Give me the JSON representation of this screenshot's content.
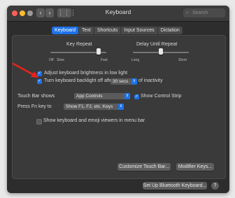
{
  "window": {
    "title": "Keyboard",
    "search_placeholder": "Search"
  },
  "nav": {
    "back": "‹",
    "forward": "›",
    "grid": "⋮⋮⋮"
  },
  "tabs": [
    {
      "label": "Keyboard",
      "active": true
    },
    {
      "label": "Text",
      "active": false
    },
    {
      "label": "Shortcuts",
      "active": false
    },
    {
      "label": "Input Sources",
      "active": false
    },
    {
      "label": "Dictation",
      "active": false
    }
  ],
  "key_repeat": {
    "label": "Key Repeat",
    "left": "Off",
    "left2": "Slow",
    "right": "Fast",
    "value": 0.86
  },
  "delay_until_repeat": {
    "label": "Delay Until Repeat",
    "left": "Long",
    "right": "Short",
    "value": 0.5
  },
  "options": {
    "adjust_brightness": {
      "label": "Adjust keyboard brightness in low light",
      "checked": true
    },
    "backlight_off": {
      "label": "Turn keyboard backlight off after",
      "checked": true,
      "value": "30 secs",
      "suffix": "of inactivity"
    },
    "touch_bar_shows": {
      "label": "Touch Bar shows",
      "value": "App Controls"
    },
    "show_control_strip": {
      "label": "Show Control Strip",
      "checked": true
    },
    "press_fn": {
      "label": "Press Fn key to",
      "value": "Show F1, F2, etc. Keys"
    },
    "show_viewers": {
      "label": "Show keyboard and emoji viewers in menu bar",
      "checked": false
    }
  },
  "buttons": {
    "customize": "Customize Touch Bar...",
    "modifier": "Modifier Keys...",
    "bluetooth": "Set Up Bluetooth Keyboard...",
    "help": "?"
  },
  "colors": {
    "accent": "#1f72e8",
    "annotation": "#e8231b"
  }
}
